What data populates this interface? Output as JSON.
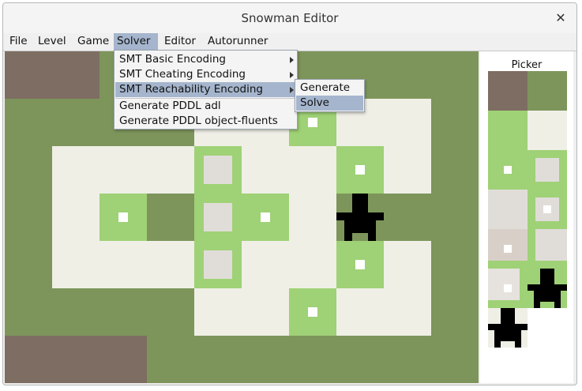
{
  "window": {
    "title": "Snowman Editor",
    "close_label": "✕"
  },
  "menubar": {
    "items": [
      {
        "label": "File"
      },
      {
        "label": "Level"
      },
      {
        "label": "Game"
      },
      {
        "label": "Solver"
      },
      {
        "label": "Editor"
      },
      {
        "label": "Autorunner"
      }
    ],
    "active_item": "Solver"
  },
  "solver_menu": {
    "items": [
      {
        "label": "SMT Basic Encoding",
        "submenu": true
      },
      {
        "label": "SMT Cheating Encoding",
        "submenu": true
      },
      {
        "label": "SMT Reachability Encoding",
        "submenu": true
      },
      {
        "label": "Generate PDDL adl",
        "submenu": false
      },
      {
        "label": "Generate PDDL object-fluents",
        "submenu": false
      }
    ],
    "highlighted": "SMT Reachability Encoding"
  },
  "reachability_submenu": {
    "items": [
      {
        "label": "Generate"
      },
      {
        "label": "Solve"
      }
    ],
    "highlighted": "Solve"
  },
  "picker": {
    "label": "Picker",
    "tiles": [
      "wall",
      "grass",
      "snow",
      "grass-snowball",
      "snow-ball",
      "grass-dark",
      "snow-player"
    ]
  },
  "colors": {
    "grass": "#7d955b",
    "snow": "#efefe6",
    "wall": "#7e6d62",
    "light_grass": "#9fd176",
    "snowball": "#e0ddd9",
    "player": "#000000",
    "menu_highlight": "#a5b5cd"
  }
}
